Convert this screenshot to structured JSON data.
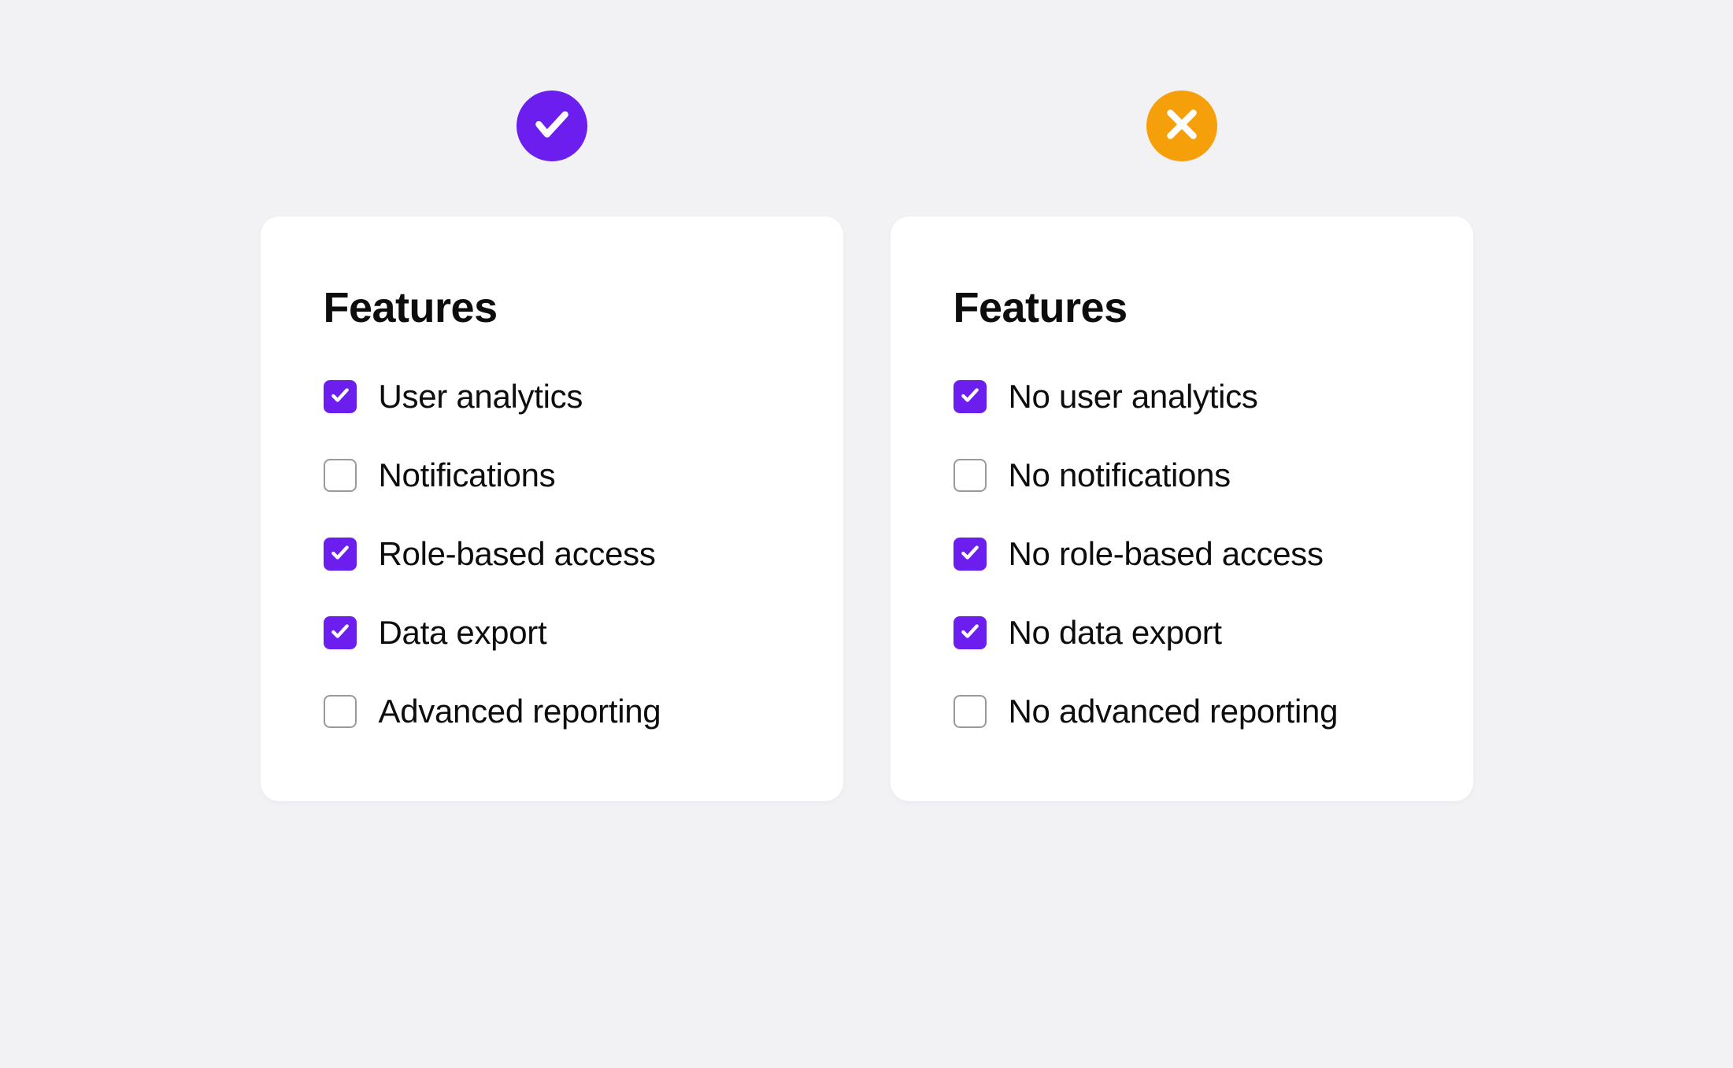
{
  "good": {
    "title": "Features",
    "items": [
      {
        "label": "User analytics",
        "checked": true
      },
      {
        "label": "Notifications",
        "checked": false
      },
      {
        "label": "Role-based access",
        "checked": true
      },
      {
        "label": "Data export",
        "checked": true
      },
      {
        "label": "Advanced reporting",
        "checked": false
      }
    ]
  },
  "bad": {
    "title": "Features",
    "items": [
      {
        "label": "No user analytics",
        "checked": true
      },
      {
        "label": "No notifications",
        "checked": false
      },
      {
        "label": "No role-based access",
        "checked": true
      },
      {
        "label": "No data export",
        "checked": true
      },
      {
        "label": "No advanced reporting",
        "checked": false
      }
    ]
  },
  "colors": {
    "accent": "#6b1eee",
    "warning": "#f5a00a"
  }
}
